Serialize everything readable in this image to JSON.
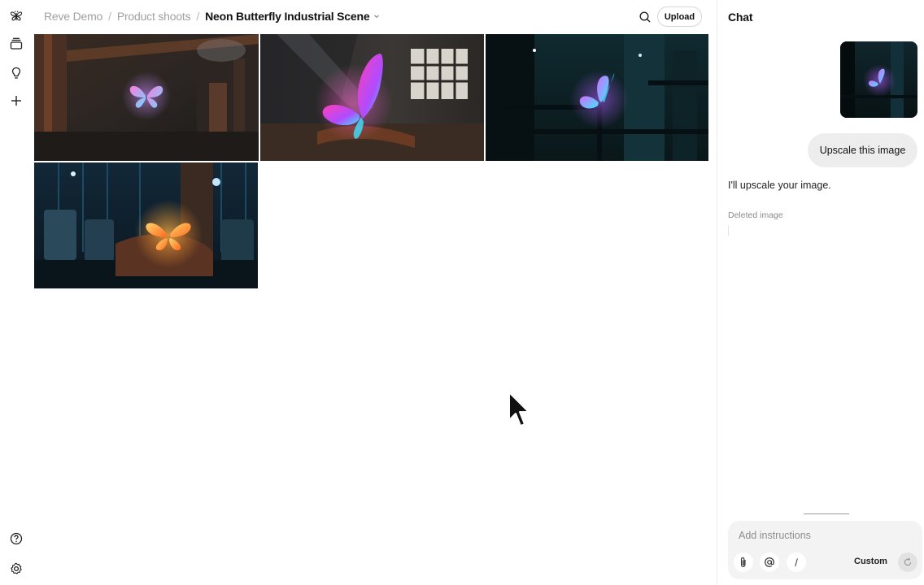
{
  "sidebar": {
    "icons": [
      "butterfly-logo-icon",
      "stack-icon",
      "lightbulb-icon",
      "plus-icon",
      "help-icon",
      "settings-icon"
    ]
  },
  "breadcrumb": {
    "workspace": "Reve Demo",
    "folder": "Product shoots",
    "project": "Neon Butterfly Industrial Scene",
    "separator": "/"
  },
  "toolbar": {
    "upload_label": "Upload"
  },
  "gallery": {
    "images": [
      "Neon Butterfly Industrial Scene 1",
      "Neon Butterfly Industrial Scene 2",
      "Neon Butterfly Industrial Scene 3",
      "Neon Butterfly Industrial Scene 4"
    ]
  },
  "chat": {
    "title": "Chat",
    "user_message": "Upscale this image",
    "assistant_message": "I'll upscale your image.",
    "deleted_note": "Deleted image",
    "input_placeholder": "Add instructions",
    "slash_label": "/",
    "custom_label": "Custom"
  },
  "colors": {
    "neon_pink": "#ff3fb4",
    "neon_violet": "#a24bff",
    "neon_cyan": "#3fe4ff",
    "neon_orange": "#ff9a2e",
    "bubble_bg": "#ededed"
  }
}
